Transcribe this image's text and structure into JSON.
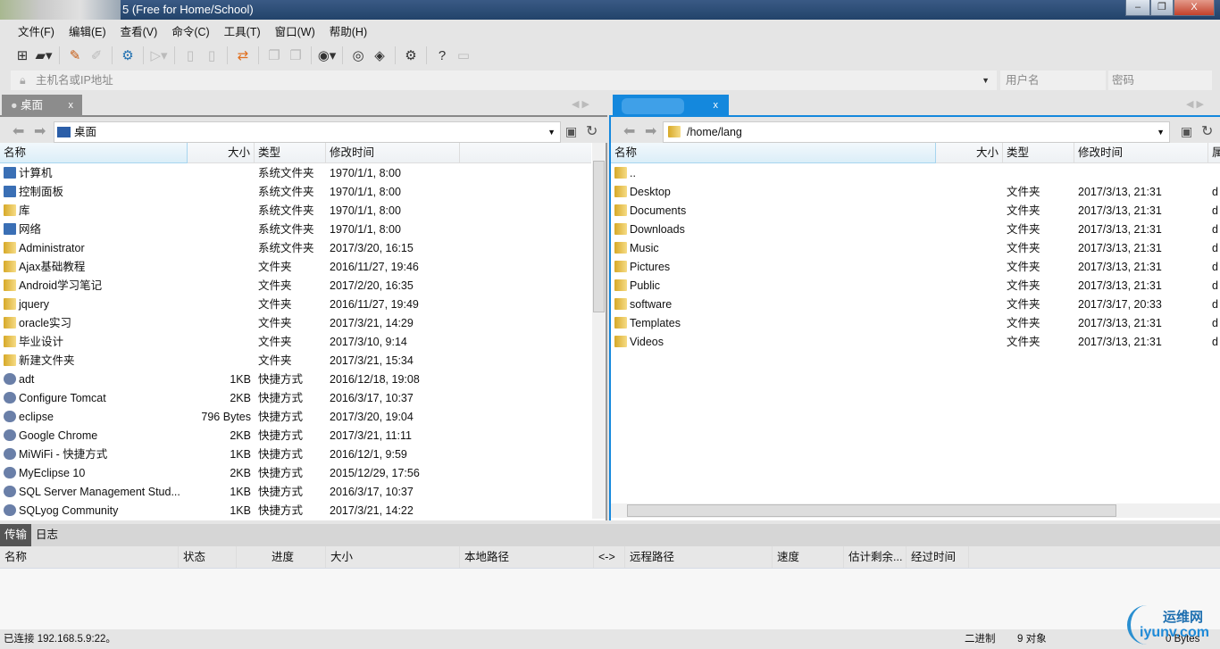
{
  "window": {
    "title": "5 (Free for Home/School)",
    "minimize": "–",
    "restore": "❐",
    "close": "X"
  },
  "menu": [
    "文件(F)",
    "编辑(E)",
    "查看(V)",
    "命令(C)",
    "工具(T)",
    "窗口(W)",
    "帮助(H)"
  ],
  "connect": {
    "host_placeholder": "主机名或IP地址",
    "user_placeholder": "用户名",
    "pass_placeholder": "密码"
  },
  "left": {
    "tab": "桌面",
    "tab_close": "x",
    "path": "桌面",
    "columns": [
      "名称",
      "大小",
      "类型",
      "修改时间"
    ],
    "rows": [
      {
        "name": "计算机",
        "size": "",
        "type": "系统文件夹",
        "date": "1970/1/1, 8:00",
        "icon": "computer-icon"
      },
      {
        "name": "控制面板",
        "size": "",
        "type": "系统文件夹",
        "date": "1970/1/1, 8:00",
        "icon": "control-panel-icon"
      },
      {
        "name": "库",
        "size": "",
        "type": "系统文件夹",
        "date": "1970/1/1, 8:00",
        "icon": "library-icon"
      },
      {
        "name": "网络",
        "size": "",
        "type": "系统文件夹",
        "date": "1970/1/1, 8:00",
        "icon": "network-icon"
      },
      {
        "name": "Administrator",
        "size": "",
        "type": "系统文件夹",
        "date": "2017/3/20, 16:15",
        "icon": "folder-icon"
      },
      {
        "name": "Ajax基础教程",
        "size": "",
        "type": "文件夹",
        "date": "2016/11/27, 19:46",
        "icon": "folder-icon"
      },
      {
        "name": "Android学习笔记",
        "size": "",
        "type": "文件夹",
        "date": "2017/2/20, 16:35",
        "icon": "folder-icon"
      },
      {
        "name": "jquery",
        "size": "",
        "type": "文件夹",
        "date": "2016/11/27, 19:49",
        "icon": "folder-icon"
      },
      {
        "name": "oracle实习",
        "size": "",
        "type": "文件夹",
        "date": "2017/3/21, 14:29",
        "icon": "folder-icon"
      },
      {
        "name": "毕业设计",
        "size": "",
        "type": "文件夹",
        "date": "2017/3/10, 9:14",
        "icon": "folder-icon"
      },
      {
        "name": "新建文件夹",
        "size": "",
        "type": "文件夹",
        "date": "2017/3/21, 15:34",
        "icon": "folder-icon"
      },
      {
        "name": "adt",
        "size": "1KB",
        "type": "快捷方式",
        "date": "2016/12/18, 19:08",
        "icon": "shortcut-icon"
      },
      {
        "name": "Configure Tomcat",
        "size": "2KB",
        "type": "快捷方式",
        "date": "2016/3/17, 10:37",
        "icon": "shortcut-icon"
      },
      {
        "name": "eclipse",
        "size": "796 Bytes",
        "type": "快捷方式",
        "date": "2017/3/20, 19:04",
        "icon": "shortcut-icon"
      },
      {
        "name": "Google Chrome",
        "size": "2KB",
        "type": "快捷方式",
        "date": "2017/3/21, 11:11",
        "icon": "shortcut-icon"
      },
      {
        "name": "MiWiFi - 快捷方式",
        "size": "1KB",
        "type": "快捷方式",
        "date": "2016/12/1, 9:59",
        "icon": "shortcut-icon"
      },
      {
        "name": "MyEclipse 10",
        "size": "2KB",
        "type": "快捷方式",
        "date": "2015/12/29, 17:56",
        "icon": "shortcut-icon"
      },
      {
        "name": "SQL Server Management Stud...",
        "size": "1KB",
        "type": "快捷方式",
        "date": "2016/3/17, 10:37",
        "icon": "shortcut-icon"
      },
      {
        "name": "SQLyog Community",
        "size": "1KB",
        "type": "快捷方式",
        "date": "2017/3/21, 14:22",
        "icon": "shortcut-icon"
      }
    ]
  },
  "right": {
    "tab_close": "x",
    "path": "/home/lang",
    "columns": [
      "名称",
      "大小",
      "类型",
      "修改时间",
      "属"
    ],
    "rows": [
      {
        "name": "..",
        "size": "",
        "type": "",
        "date": "",
        "attr": ""
      },
      {
        "name": "Desktop",
        "size": "",
        "type": "文件夹",
        "date": "2017/3/13, 21:31",
        "attr": "d"
      },
      {
        "name": "Documents",
        "size": "",
        "type": "文件夹",
        "date": "2017/3/13, 21:31",
        "attr": "d"
      },
      {
        "name": "Downloads",
        "size": "",
        "type": "文件夹",
        "date": "2017/3/13, 21:31",
        "attr": "d"
      },
      {
        "name": "Music",
        "size": "",
        "type": "文件夹",
        "date": "2017/3/13, 21:31",
        "attr": "d"
      },
      {
        "name": "Pictures",
        "size": "",
        "type": "文件夹",
        "date": "2017/3/13, 21:31",
        "attr": "d"
      },
      {
        "name": "Public",
        "size": "",
        "type": "文件夹",
        "date": "2017/3/13, 21:31",
        "attr": "d"
      },
      {
        "name": "software",
        "size": "",
        "type": "文件夹",
        "date": "2017/3/17, 20:33",
        "attr": "d"
      },
      {
        "name": "Templates",
        "size": "",
        "type": "文件夹",
        "date": "2017/3/13, 21:31",
        "attr": "d"
      },
      {
        "name": "Videos",
        "size": "",
        "type": "文件夹",
        "date": "2017/3/13, 21:31",
        "attr": "d"
      }
    ]
  },
  "transfer": {
    "tabs": [
      "传输",
      "日志"
    ],
    "columns": [
      "名称",
      "状态",
      "进度",
      "大小",
      "本地路径",
      "<->",
      "远程路径",
      "速度",
      "估计剩余...",
      "经过时间"
    ]
  },
  "status": {
    "connection": "已连接 192.168.5.9:22。",
    "mode": "二进制",
    "objects": "9 对象",
    "size": "0 Bytes"
  },
  "watermark": {
    "line1": "运维网",
    "line2": "iyunv.com"
  }
}
